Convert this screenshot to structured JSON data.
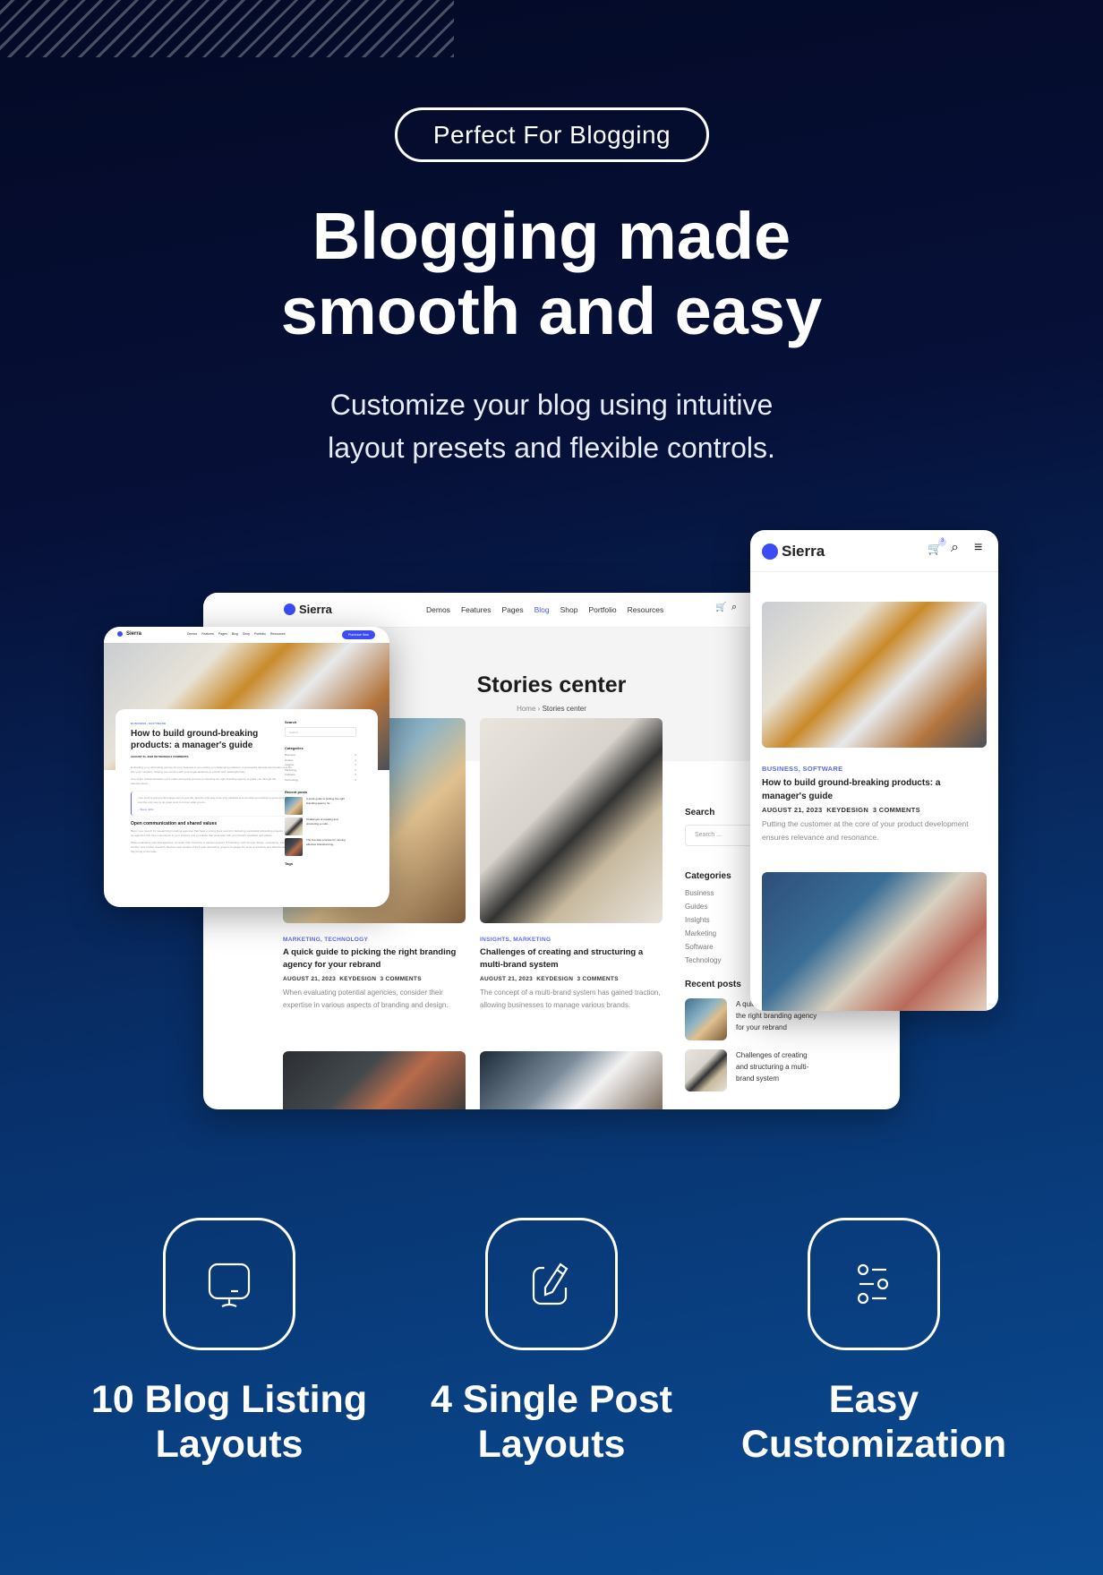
{
  "badge": "Perfect For Blogging",
  "headline": [
    "Blogging made",
    "smooth and easy"
  ],
  "subtitle": [
    "Customize your blog using intuitive",
    "layout presets and flexible controls."
  ],
  "brand": "Sierra",
  "colors": {
    "accent": "#4b5cf0",
    "bg_top": "#040a26",
    "bg_bottom": "#0a4c93"
  },
  "desktop": {
    "nav": [
      "Demos",
      "Features",
      "Pages",
      "Blog",
      "Shop",
      "Portfolio",
      "Resources"
    ],
    "active_nav": "Blog",
    "hero_title": "Stories center",
    "breadcrumb": {
      "home": "Home",
      "sep": "›",
      "current": "Stories center"
    },
    "posts": [
      {
        "category": "MARKETING, TECHNOLOGY",
        "title": "A quick guide to picking the right branding agency for your rebrand",
        "date": "AUGUST 21, 2023",
        "author": "KEYDESIGN",
        "comments": "3 COMMENTS",
        "excerpt": "When evaluating potential agencies, consider their expertise in various aspects of branding and design."
      },
      {
        "category": "INSIGHTS, MARKETING",
        "title": "Challenges of creating and structuring a multi-brand system",
        "date": "AUGUST 21, 2023",
        "author": "KEYDESIGN",
        "comments": "3 COMMENTS",
        "excerpt": "The concept of a multi-brand system has gained traction, allowing businesses to manage various brands."
      }
    ],
    "sidebar": {
      "search_title": "Search",
      "search_placeholder": "Search ...",
      "categories_title": "Categories",
      "categories": [
        "Business",
        "Guides",
        "Insights",
        "Marketing",
        "Software",
        "Technology"
      ],
      "recent_title": "Recent posts",
      "recent": [
        "A quick guide to picking the right branding agency for your rebrand",
        "Challenges of creating and structuring a multi-brand system"
      ]
    }
  },
  "single": {
    "nav": [
      "Demos",
      "Features",
      "Pages",
      "Blog",
      "Shop",
      "Portfolio",
      "Resources"
    ],
    "cta": "Purchase Now",
    "category": "BUSINESS, SOFTWARE",
    "title": "How to build ground-breaking products: a manager's guide",
    "meta": "AUGUST 21, 2023   KEYDESIGN   3 COMMENTS",
    "para1": "Embarking on a rebranding journey for your business is an exciting yet challenging endeavor. A successful rebrand can breathe new life into your company, helping you connect with your target audience in a fresh and meaningful way.",
    "para2": "One of the critical decisions you'll make during this process is choosing the right branding agency to guide you through the transformation.",
    "quote": "Your work is going to fill a large part of your life, and the only way to be truly satisfied is to do what you believe is great work. And the only way to do great work is to love what you do.",
    "quote_author": "– Steve Jobs",
    "h2": "Open communication and shared values",
    "para3": "Begin your search by researching branding agencies that have a strong track record in delivering successful rebranding projects. Look for agencies that have experience in your industry and a portfolio that resonates with your brand's aesthetic and values.",
    "para4": "When evaluating potential agencies, consider their expertise in various aspects of branding, such as logo design, messaging, visual identity, and market research. Review case studies of their past rebranding projects to gauge the level of creativity and effectiveness they bring to the table.",
    "sidebar": {
      "search_title": "Search",
      "search_placeholder": "Search ...",
      "categories_title": "Categories",
      "categories": [
        {
          "name": "Business",
          "count": "2"
        },
        {
          "name": "Guides",
          "count": "2"
        },
        {
          "name": "Insights",
          "count": "2"
        },
        {
          "name": "Marketing",
          "count": "2"
        },
        {
          "name": "Software",
          "count": "2"
        },
        {
          "name": "Technology",
          "count": "2"
        }
      ],
      "recent_title": "Recent posts",
      "recent": [
        "A quick guide to picking the right branding agency for...",
        "Challenges of creating and structuring a multi-...",
        "The five-step process for running effective brainstorming..."
      ],
      "tags_title": "Tags"
    }
  },
  "mobile": {
    "cart_count": "3",
    "category": "BUSINESS, SOFTWARE",
    "title": "How to build ground-breaking products: a manager's guide",
    "date": "AUGUST 21, 2023",
    "author": "KEYDESIGN",
    "comments": "3 COMMENTS",
    "excerpt": "Putting the customer at the core of your product development ensures relevance and resonance."
  },
  "features": [
    {
      "icon": "monitor-icon",
      "label": [
        "10 Blog Listing",
        "Layouts"
      ]
    },
    {
      "icon": "edit-icon",
      "label": [
        "4 Single Post",
        "Layouts"
      ]
    },
    {
      "icon": "sliders-icon",
      "label": [
        "Easy",
        "Customization"
      ]
    }
  ]
}
